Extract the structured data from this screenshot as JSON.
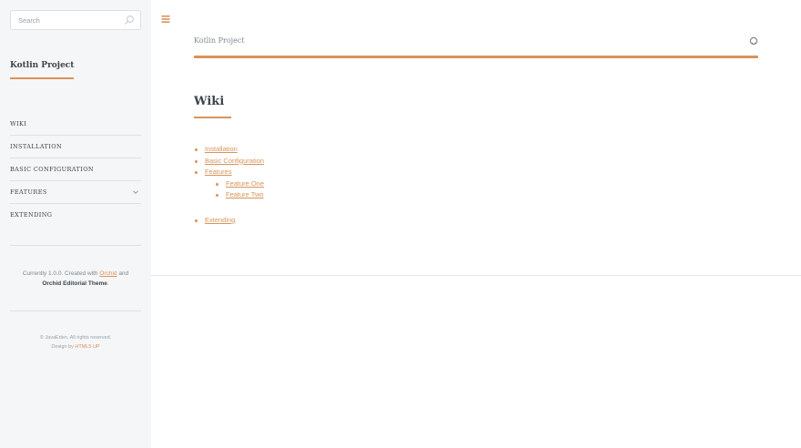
{
  "search": {
    "placeholder": "Search"
  },
  "sidebar": {
    "title": "Kotlin Project",
    "menu": [
      {
        "label": "WIKI"
      },
      {
        "label": "INSTALLATION"
      },
      {
        "label": "BASIC CONFIGURATION"
      },
      {
        "label": "FEATURES"
      },
      {
        "label": "EXTENDING"
      }
    ],
    "footer": {
      "currently_prefix": "Currently 1.0.0. Created with ",
      "orchid_link": "Orchid",
      "and_text": " and",
      "theme_name": "Orchid Editorial Theme",
      "period": ".",
      "copyright": "© JavaEden. All rights reserved.",
      "design_prefix": "Design by ",
      "design_link": "HTML5 UP"
    }
  },
  "header": {
    "title": "Kotlin Project"
  },
  "page": {
    "title": "Wiki",
    "toc": {
      "installation": "Installation",
      "basic_configuration": "Basic Configuration",
      "features": "Features",
      "feature_one": "Feature One",
      "feature_two": "Feature Two",
      "extending": "Extending"
    }
  },
  "colors": {
    "accent": "#d9935a",
    "sidebar_bg": "#f5f6f7",
    "heading": "#3d4449",
    "text": "#7f888f"
  },
  "icons": {
    "search": "search-icon",
    "menu": "hamburger-menu-icon",
    "github": "github-icon",
    "chevron": "chevron-down-icon"
  }
}
